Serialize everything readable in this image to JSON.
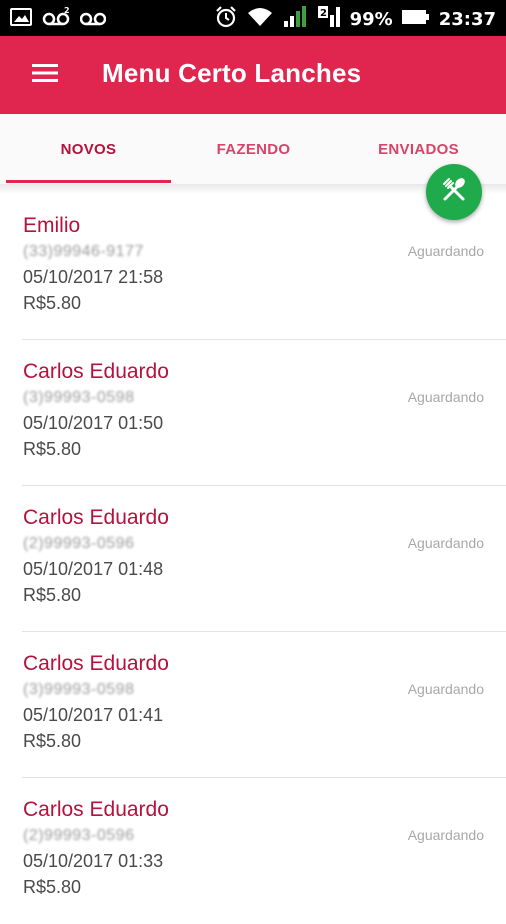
{
  "status_bar": {
    "icons_left": [
      "image-icon",
      "voicemail-icon",
      "voicemail-icon"
    ],
    "signal_label": "2",
    "battery": "99%",
    "time": "23:37"
  },
  "app_bar": {
    "title": "Menu Certo Lanches",
    "color": "#e0264f"
  },
  "tabs": [
    {
      "label": "NOVOS",
      "active": true
    },
    {
      "label": "FAZENDO",
      "active": false
    },
    {
      "label": "ENVIADOS",
      "active": false
    }
  ],
  "fab": {
    "icon": "fork-knife-icon",
    "color": "#1faa4b"
  },
  "orders": [
    {
      "name": "Emilio",
      "phone": "(33)99946-9177",
      "date": "05/10/2017 21:58",
      "price": "R$5.80",
      "status": "Aguardando"
    },
    {
      "name": "Carlos Eduardo",
      "phone": "(3)99993-0598",
      "date": "05/10/2017 01:50",
      "price": "R$5.80",
      "status": "Aguardando"
    },
    {
      "name": "Carlos Eduardo",
      "phone": "(2)99993-0596",
      "date": "05/10/2017 01:48",
      "price": "R$5.80",
      "status": "Aguardando"
    },
    {
      "name": "Carlos Eduardo",
      "phone": "(3)99993-0598",
      "date": "05/10/2017 01:41",
      "price": "R$5.80",
      "status": "Aguardando"
    },
    {
      "name": "Carlos Eduardo",
      "phone": "(2)99993-0596",
      "date": "05/10/2017 01:33",
      "price": "R$5.80",
      "status": "Aguardando"
    }
  ]
}
